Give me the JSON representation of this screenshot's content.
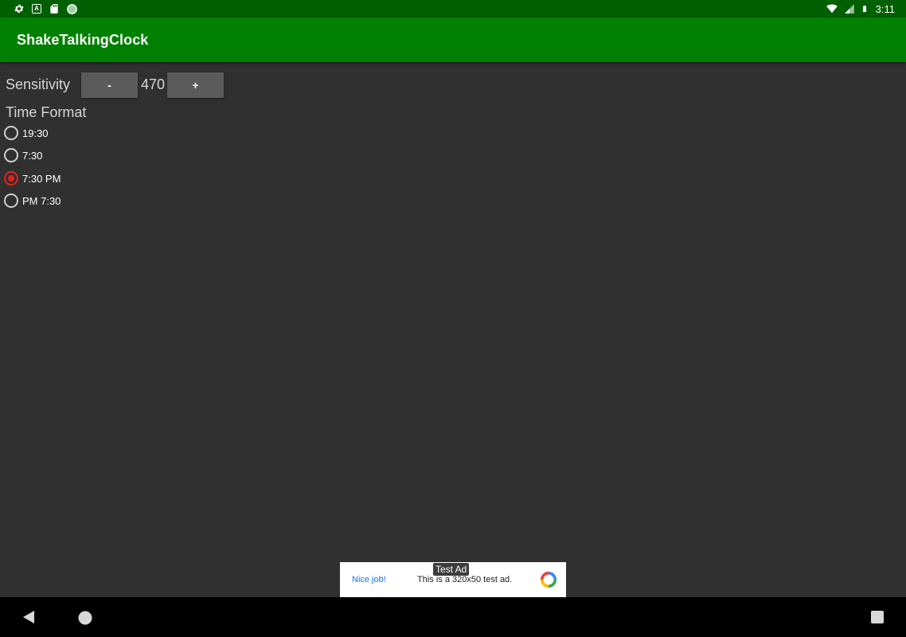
{
  "status_bar": {
    "time": "3:11",
    "left_icons": [
      "settings-icon",
      "keyboard-a-icon",
      "sd-card-icon",
      "circle-icon"
    ],
    "right_icons": [
      "wifi-icon",
      "signal-icon",
      "battery-icon"
    ]
  },
  "app_bar": {
    "title": "ShakeTalkingClock",
    "color": "#008000"
  },
  "sensitivity": {
    "label": "Sensitivity",
    "minus_label": "-",
    "value": "470",
    "plus_label": "+"
  },
  "time_format": {
    "label": "Time Format",
    "options": [
      {
        "label": "19:30",
        "checked": false
      },
      {
        "label": "7:30",
        "checked": false
      },
      {
        "label": "7:30 PM",
        "checked": true
      },
      {
        "label": "PM 7:30",
        "checked": false
      }
    ],
    "accent_color": "#e0241b"
  },
  "ad": {
    "badge": "Test Ad",
    "nice": "Nice job!",
    "description": "This is a 320x50 test ad."
  },
  "nav_bar": {
    "icons": [
      "back-icon",
      "home-icon",
      "recents-icon"
    ]
  }
}
